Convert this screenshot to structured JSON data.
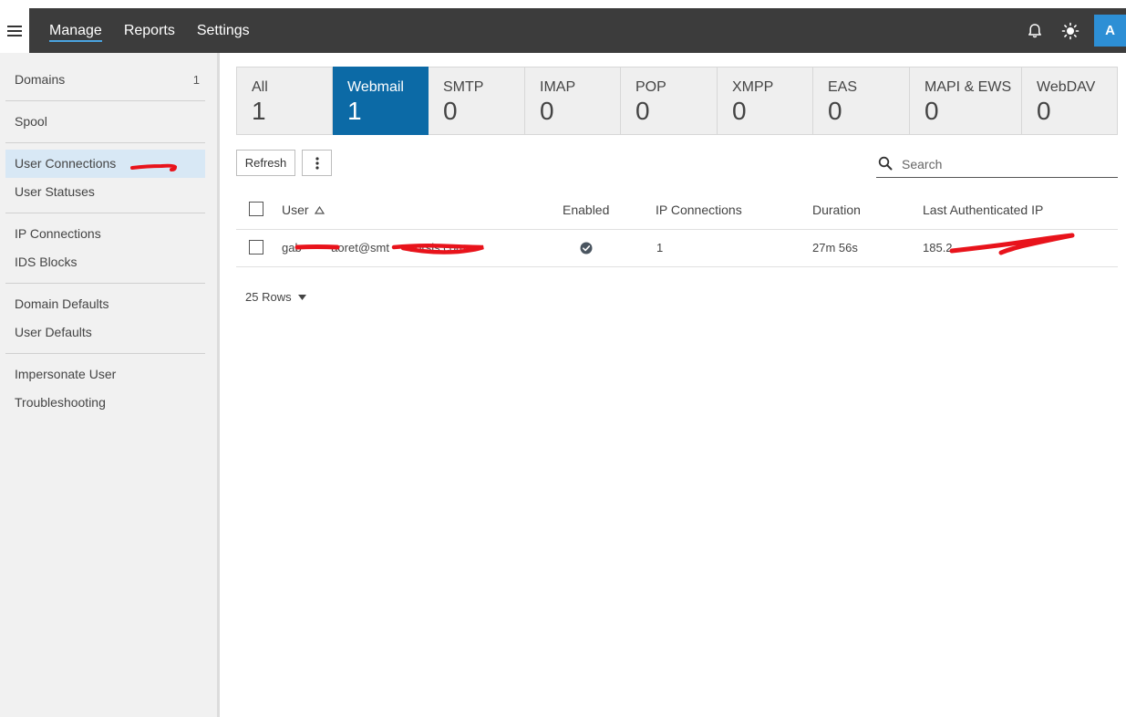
{
  "header": {
    "nav": [
      "Manage",
      "Reports",
      "Settings"
    ],
    "active_nav": "Manage",
    "avatar_initial": "A"
  },
  "sidebar": {
    "items": [
      {
        "label": "Domains",
        "count": "1"
      },
      {
        "label": "Spool"
      },
      {
        "label": "User Connections"
      },
      {
        "label": "User Statuses"
      },
      {
        "label": "IP Connections"
      },
      {
        "label": "IDS Blocks"
      },
      {
        "label": "Domain Defaults"
      },
      {
        "label": "User Defaults"
      },
      {
        "label": "Impersonate User"
      },
      {
        "label": "Troubleshooting"
      }
    ],
    "active": "User Connections"
  },
  "tabs": [
    {
      "label": "All",
      "count": "1"
    },
    {
      "label": "Webmail",
      "count": "1"
    },
    {
      "label": "SMTP",
      "count": "0"
    },
    {
      "label": "IMAP",
      "count": "0"
    },
    {
      "label": "POP",
      "count": "0"
    },
    {
      "label": "XMPP",
      "count": "0"
    },
    {
      "label": "EAS",
      "count": "0"
    },
    {
      "label": "MAPI & EWS",
      "count": "0"
    },
    {
      "label": "WebDAV",
      "count": "0"
    }
  ],
  "active_tab": "Webmail",
  "toolbar": {
    "refresh_label": "Refresh",
    "search_placeholder": "Search"
  },
  "table": {
    "columns": [
      "User",
      "Enabled",
      "IP Connections",
      "Duration",
      "Last Authenticated IP"
    ],
    "sort_column": "User",
    "rows": [
      {
        "user": "gab         aoret@smt      sorsis.com",
        "enabled": true,
        "ip_connections": "1",
        "duration": "27m 56s",
        "last_ip": "185.2"
      }
    ]
  },
  "pagination": {
    "rows_label": "25 Rows"
  },
  "colors": {
    "header_bg": "#3c3c3c",
    "active_tab": "#0c6aa6",
    "avatar": "#2d8fd5",
    "sidebar_active": "#d8e8f5",
    "redaction": "#e8131b"
  }
}
